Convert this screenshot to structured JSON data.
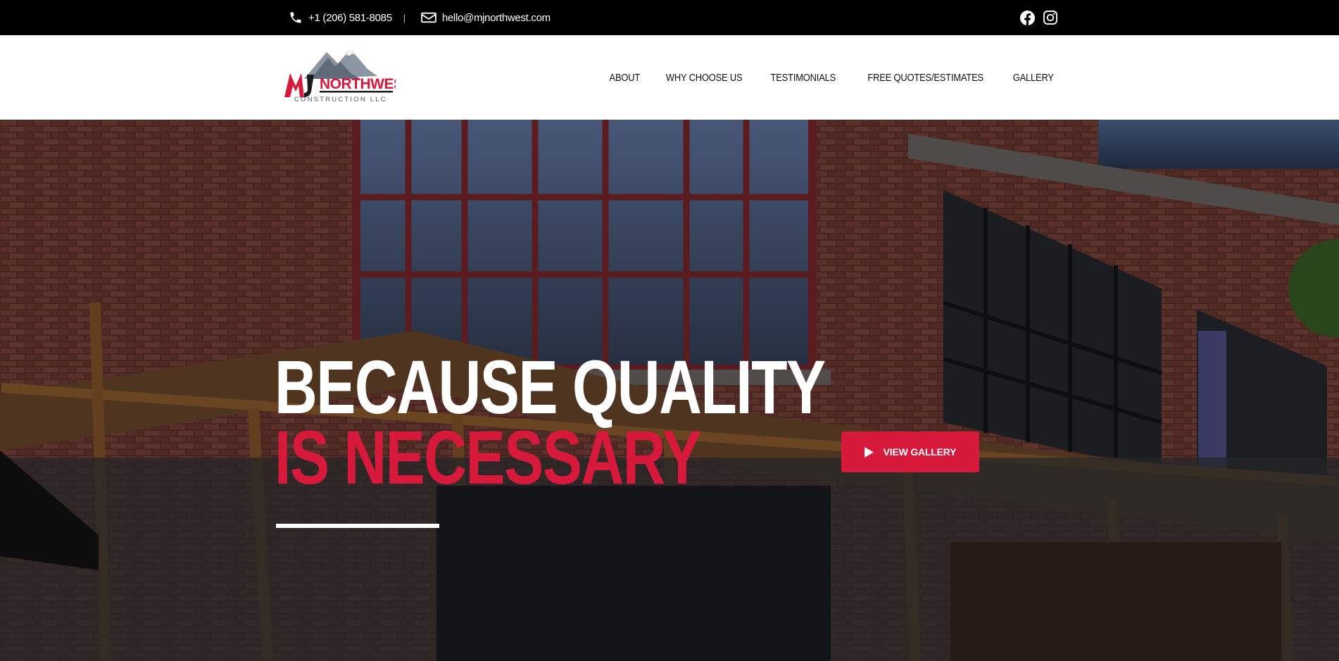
{
  "topbar": {
    "phone": "+1 (206) 581-8085",
    "separator": "|",
    "email": "hello@mjnorthwest.com",
    "social_icons": [
      "facebook-icon",
      "instagram-icon"
    ]
  },
  "header": {
    "logo": {
      "name": "NORTHWEST",
      "subtitle": "CONSTRUCTION LLC",
      "monogram": "MJ"
    },
    "nav": [
      {
        "label": "ABOUT"
      },
      {
        "label": "WHY CHOOSE US"
      },
      {
        "label": "TESTIMONIALS"
      },
      {
        "label": "FREE QUOTES/ESTIMATES"
      },
      {
        "label": "GALLERY"
      }
    ]
  },
  "hero": {
    "headline_line1": "BECAUSE QUALITY",
    "headline_line2": "IS NECESSARY",
    "cta_label": "VIEW GALLERY",
    "cta_icon": "play-icon"
  },
  "colors": {
    "accent": "#d71a3c",
    "topbar_bg": "#000000",
    "header_bg": "#ffffff"
  }
}
